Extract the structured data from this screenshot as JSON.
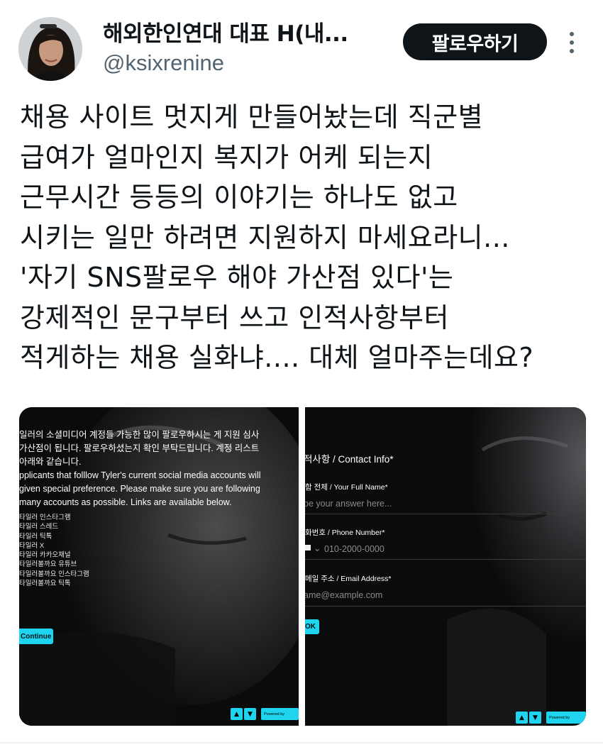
{
  "tweet": {
    "display_name": "해외한인연대 대표 H(내...",
    "handle": "@ksixrenine",
    "follow_label": "팔로우하기",
    "more_icon": "more-vertical-icon",
    "text_lines": [
      "채용 사이트 멋지게 만들어놨는데 직군별",
      "급여가 얼마인지 복지가 어케 되는지",
      "근무시간 등등의 이야기는 하나도 없고",
      "시키는 일만 하려면 지원하지 마세요라니...",
      "'자기 SNS팔로우 해야 가산점 있다'는",
      "강제적인 문구부터 쓰고 인적사항부터",
      "적게하는 채용 실화냐.... 대체 얼마주는데요?"
    ]
  },
  "media_left": {
    "korean_lines": [
      "일러의 소셜미디어 계정들 가능한 많이 팔로우하시는 게 지원 심사",
      "가산점이 됩니다. 팔로우하셨는지 확인 부탁드립니다. 계정 리스트",
      "아래와 같습니다."
    ],
    "english_lines": [
      "pplicants that folllow Tyler's current social media accounts will",
      "given special preference. Please make sure you are following",
      "many accounts as possible. Links are available below."
    ],
    "links": [
      "타일러 인스타그램",
      "타일러 스레드",
      "타일러 틱톡",
      "타일러 X",
      "타일러 카카오채널",
      "타일러볼까요 유튜브",
      "타일러볼까요 인스타그램",
      "타일러볼까요 틱톡"
    ],
    "continue_label": "Continue",
    "powered_label": "Powered by"
  },
  "media_right": {
    "section_title": "적사항 / Contact Info*",
    "fields": [
      {
        "label": "함 전체 / Your Full Name*",
        "placeholder": "pe your answer here..."
      },
      {
        "label": "화번호 / Phone Number*",
        "placeholder": "010-2000-0000"
      },
      {
        "label": "메일 주소 / Email Address*",
        "placeholder": "ame@example.com"
      }
    ],
    "ok_label": "OK",
    "powered_label": "Powered by"
  },
  "colors": {
    "accent": "#1fd4ee",
    "text": "#0f1419",
    "muted": "#536471"
  }
}
